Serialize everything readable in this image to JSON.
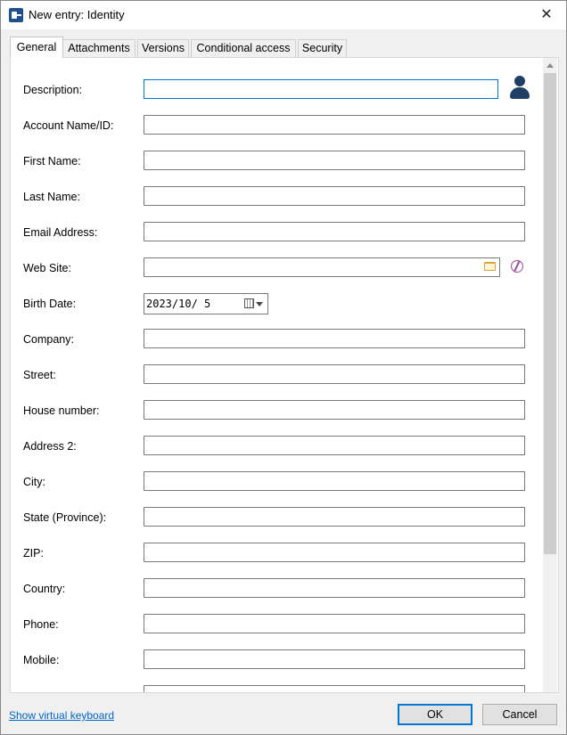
{
  "window": {
    "title": "New entry: Identity",
    "close_glyph": "✕"
  },
  "tabs": [
    {
      "label": "General",
      "active": true
    },
    {
      "label": "Attachments",
      "active": false
    },
    {
      "label": "Versions",
      "active": false
    },
    {
      "label": "Conditional access",
      "active": false
    },
    {
      "label": "Security",
      "active": false
    }
  ],
  "form": {
    "description": "Description:",
    "account": "Account Name/ID:",
    "first_name": "First Name:",
    "last_name": "Last Name:",
    "email": "Email Address:",
    "web_site": "Web Site:",
    "birth_date": "Birth Date:",
    "birth_date_value": "2023/10/ 5",
    "company": "Company:",
    "street": "Street:",
    "house_number": "House number:",
    "address2": "Address 2:",
    "city": "City:",
    "state": "State (Province):",
    "zip": "ZIP:",
    "country": "Country:",
    "phone": "Phone:",
    "mobile": "Mobile:"
  },
  "footer": {
    "virtual_keyboard": "Show virtual keyboard",
    "ok": "OK",
    "cancel": "Cancel"
  },
  "icons": {
    "app": "app-key-icon",
    "user": "user-icon",
    "folder": "folder-icon",
    "globe": "globe-icon",
    "calendar": "calendar-icon"
  },
  "colors": {
    "accent": "#0078d7",
    "user_icon": "#1f3f66",
    "link": "#0066cc"
  }
}
